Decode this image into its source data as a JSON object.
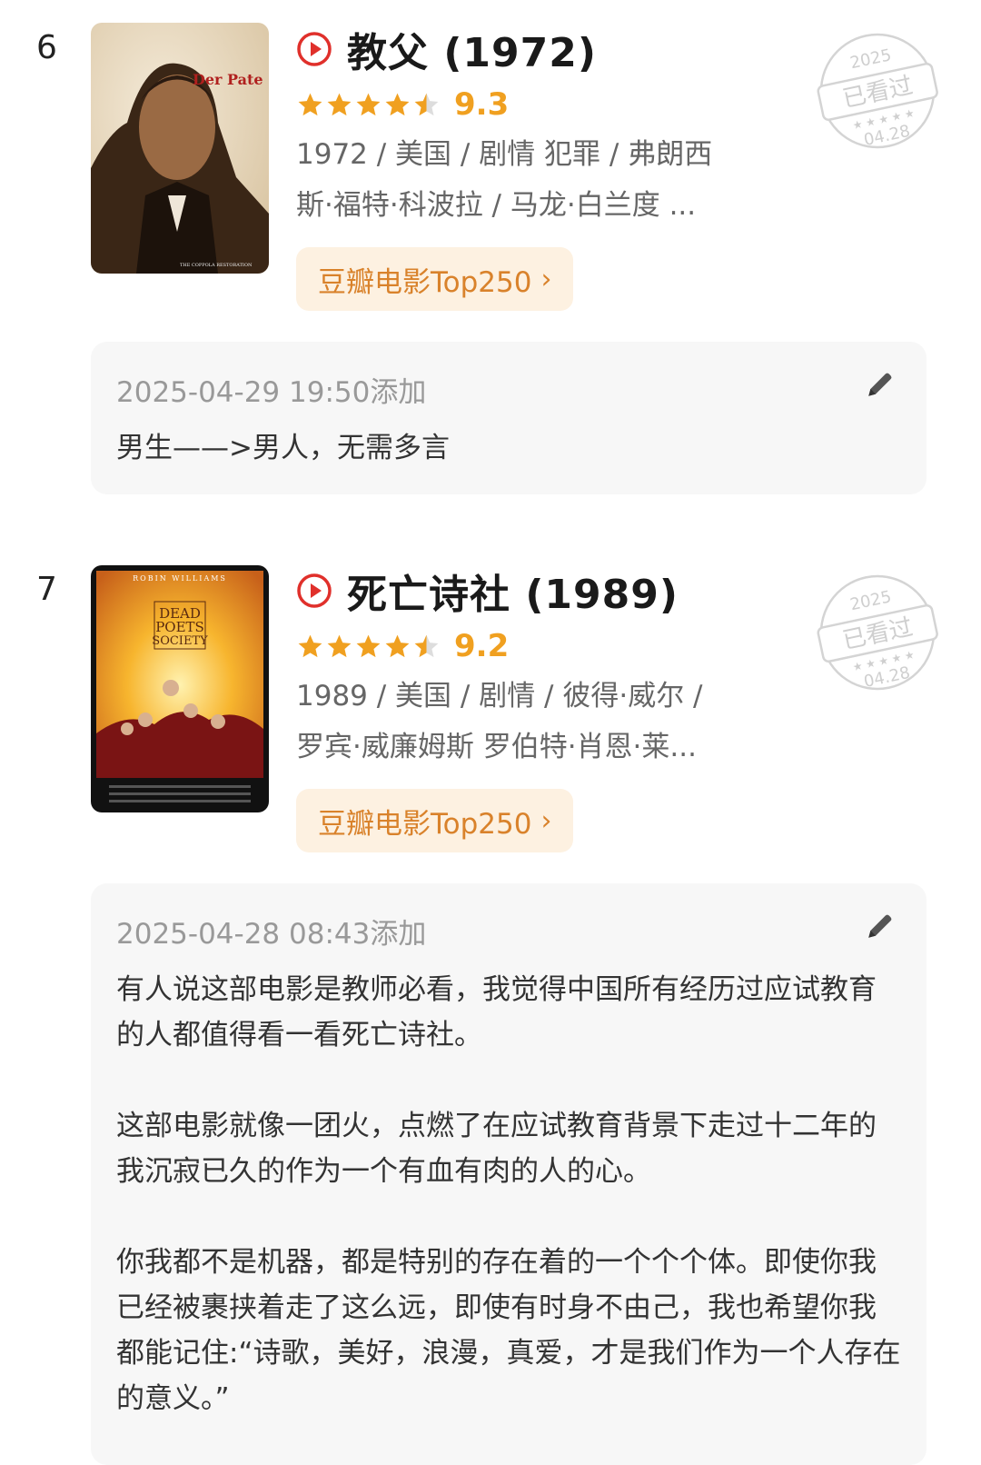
{
  "colors": {
    "accent": "#f0a020",
    "play": "#e0302b",
    "pill_bg": "#fdf1e1",
    "pill_text": "#d9822b",
    "note_bg": "#f7f7f7"
  },
  "entries": [
    {
      "rank": "6",
      "title": "教父 (1972)",
      "score": "9.3",
      "stars": 4.5,
      "meta_line1": "1972 / 美国 / 剧情 犯罪 / 弗朗西",
      "meta_line2": "斯·福特·科波拉 / 马龙·白兰度 ...",
      "tag": "豆瓣电影Top250",
      "poster_text": "Der Pate",
      "poster_caption": "THE COPPOLA RESTORATION",
      "stamp_year": "2025",
      "stamp_label": "已看过",
      "stamp_date": "04.28",
      "note_date": "2025-04-29 19:50添加",
      "note_text": "男生——>男人，无需多言"
    },
    {
      "rank": "7",
      "title": "死亡诗社 (1989)",
      "score": "9.2",
      "stars": 4.5,
      "meta_line1": "1989 / 美国 / 剧情 / 彼得·威尔 /",
      "meta_line2": "罗宾·威廉姆斯 罗伯特·肖恩·莱...",
      "tag": "豆瓣电影Top250",
      "poster_text_top": "ROBIN WILLIAMS",
      "poster_text_1": "DEAD",
      "poster_text_2": "POETS",
      "poster_text_3": "SOCIETY",
      "stamp_year": "2025",
      "stamp_label": "已看过",
      "stamp_date": "04.28",
      "note_date": "2025-04-28 08:43添加",
      "note_text": "有人说这部电影是教师必看，我觉得中国所有经历过应试教育的人都值得看一看死亡诗社。\n\n这部电影就像一团火，点燃了在应试教育背景下走过十二年的我沉寂已久的作为一个有血有肉的人的心。\n\n你我都不是机器，都是特别的存在着的一个个个体。即使你我已经被裹挟着走了这么远，即使有时身不由己，我也希望你我都能记住:“诗歌，美好，浪漫，真爱，才是我们作为一个人存在的意义。”"
    }
  ]
}
